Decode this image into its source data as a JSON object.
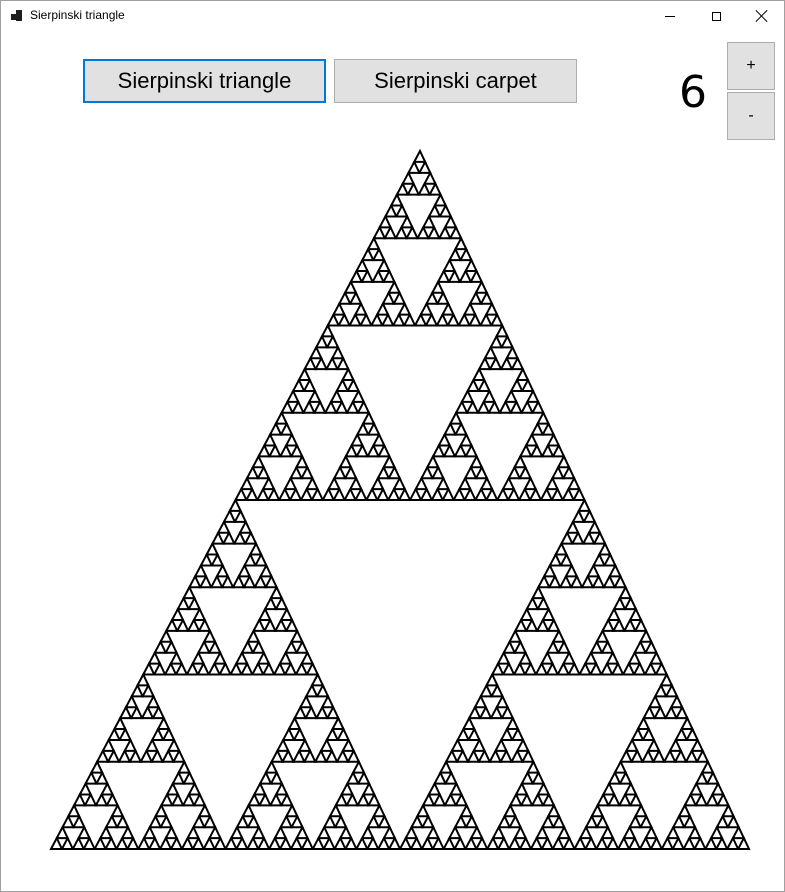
{
  "window": {
    "title": "Sierpinski triangle",
    "controls": {
      "minimize": "minimize",
      "maximize": "maximize",
      "close": "close"
    }
  },
  "toolbar": {
    "triangle_button_label": "Sierpinski triangle",
    "carpet_button_label": "Sierpinski carpet",
    "increase_label": "+",
    "decrease_label": "-",
    "depth_value": "6"
  },
  "fractal": {
    "type": "sierpinski-triangle",
    "depth": 6,
    "stroke_color": "#000000",
    "background_color": "#ffffff"
  }
}
